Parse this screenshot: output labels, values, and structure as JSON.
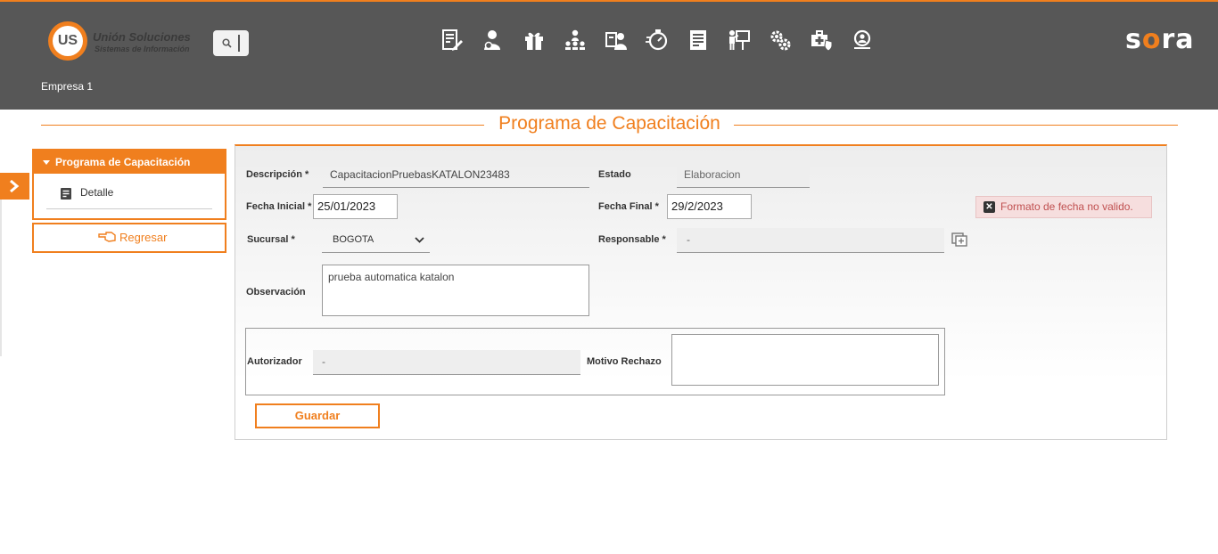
{
  "header": {
    "logo_name": "Unión Soluciones",
    "logo_tagline": "Sistemas de Información",
    "logo_mark": "US",
    "brand": "sora",
    "company": "Empresa 1",
    "modules": [
      "contract-edit-icon",
      "user-payroll-icon",
      "gift-icon",
      "org-chart-icon",
      "employee-card-icon",
      "timer-icon",
      "document-icon",
      "training-icon",
      "settings-gears-icon",
      "health-kit-icon",
      "search-person-icon"
    ]
  },
  "page": {
    "title": "Programa de Capacitación"
  },
  "sidebar": {
    "section_title": "Programa de Capacitación",
    "items": [
      {
        "label": "Detalle"
      }
    ],
    "back_label": "Regresar"
  },
  "form": {
    "descripcion_label": "Descripción *",
    "descripcion_value": "CapacitacionPruebasKATALON23483",
    "estado_label": "Estado",
    "estado_value": "Elaboracion",
    "fecha_inicial_label": "Fecha Inicial *",
    "fecha_inicial_value": "25/01/2023",
    "fecha_final_label": "Fecha Final *",
    "fecha_final_value": "29/2/2023",
    "error_message": "Formato de fecha no valido.",
    "sucursal_label": "Sucursal *",
    "sucursal_value": "BOGOTA",
    "responsable_label": "Responsable *",
    "responsable_value": "-",
    "observacion_label": "Observación",
    "observacion_value": "prueba automatica katalon",
    "autorizador_label": "Autorizador",
    "autorizador_value": "-",
    "motivo_label": "Motivo Rechazo",
    "motivo_value": "",
    "save_label": "Guardar"
  },
  "colors": {
    "accent": "#f07f1e",
    "header_bg": "#575757",
    "error_bg": "#f6dede"
  }
}
